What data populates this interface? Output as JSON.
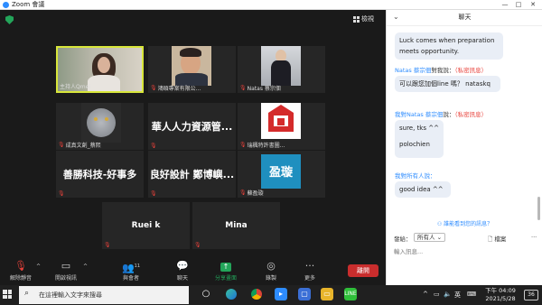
{
  "titlebar": {
    "title": "Zoom 會議",
    "minimize": "—",
    "maximize": "□",
    "close": "✕"
  },
  "meeting": {
    "gallery_label": "檢視",
    "tiles": [
      {
        "name": "主持人Qmei",
        "mic_off": false
      },
      {
        "name": "鴻碩專案有限公...",
        "mic_off": true
      },
      {
        "name": "Natas 蔡宗佃",
        "mic_off": true
      },
      {
        "name": "成真文創_蔡熙",
        "mic_off": true
      },
      {
        "name": "",
        "big": "華人人力資源管...",
        "mic_off": true
      },
      {
        "name": "瑞楓特許書圖...",
        "mic_off": true
      },
      {
        "name": "",
        "big": "善勝科技-好事多",
        "mic_off": true
      },
      {
        "name": "",
        "big": "良好設計 鄭博嶼...",
        "mic_off": true
      },
      {
        "name": "蘇盈璇",
        "big": "盈璇",
        "mic_off": true
      },
      {
        "name": "",
        "big": "Ruei k",
        "mic_off": true
      },
      {
        "name": "",
        "big": "Mina",
        "mic_off": true
      }
    ]
  },
  "toolbar": {
    "mute": "解除靜音",
    "video": "開啟視訊",
    "participants": "與會者",
    "participants_count": "11",
    "chat": "聊天",
    "share": "分享畫面",
    "record": "錄製",
    "more": "更多",
    "leave": "離開"
  },
  "chat": {
    "title": "聊天",
    "messages": [
      {
        "text": "Luck comes when preparation meets opportunity."
      },
      {
        "from": "Natas 蔡宗佃",
        "to": "對我說：",
        "private": "（私密訊息）",
        "text": "可以跟您加個line 嗎？ nataskq"
      },
      {
        "from": "我對",
        "to_name": "Natas 蔡宗佃",
        "to": "說：",
        "private": "（私密訊息）",
        "text_line1": "sure, tks ^^",
        "text_line2": "polochien"
      },
      {
        "from": "我對所有人說：",
        "text": "good idea ^^"
      }
    ],
    "who_can_see": "誰能看到您的訊息？",
    "to_label": "發給：",
    "to_value": "所有人",
    "file_label": "檔案",
    "more_label": "···",
    "input_placeholder": "輸入訊息..."
  },
  "taskbar": {
    "search_placeholder": "在這裡輸入文字來搜尋",
    "lang": "英",
    "time": "下午 04:09",
    "date": "2021/5/28",
    "notif_count": "36"
  }
}
